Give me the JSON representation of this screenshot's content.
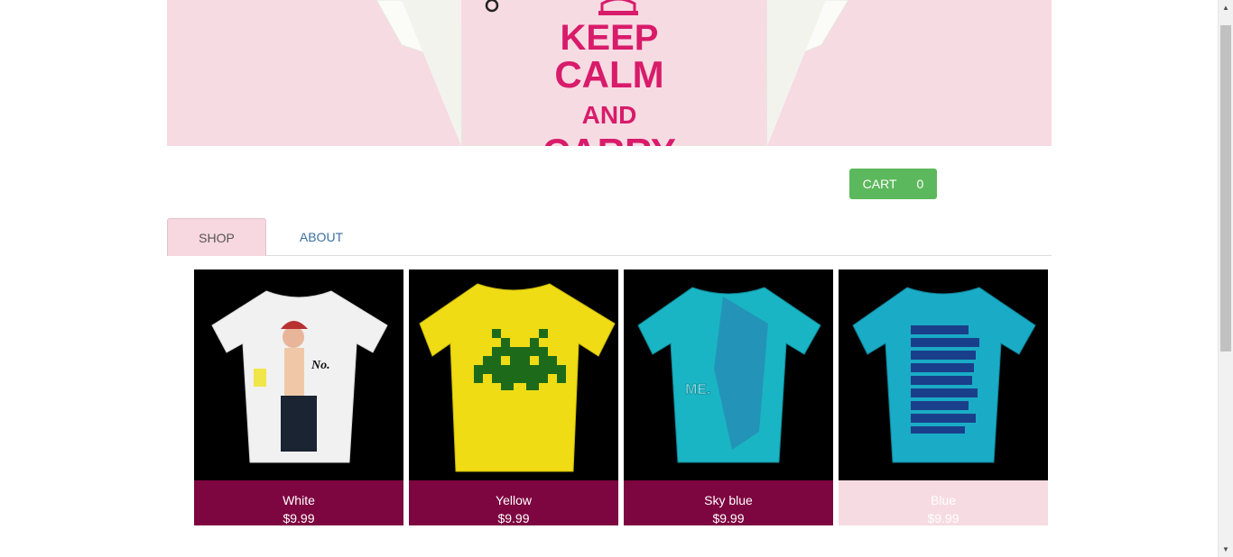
{
  "banner": {
    "line1": "KEEP",
    "line2": "CALM",
    "line3": "AND",
    "line4": "CARRY"
  },
  "cart": {
    "label": "CART",
    "count": "0"
  },
  "tabs": [
    {
      "label": "SHOP"
    },
    {
      "label": "ABOUT"
    }
  ],
  "products": [
    {
      "name": "White",
      "price": "$9.99",
      "shirt_color": "#f1f1f1"
    },
    {
      "name": "Yellow",
      "price": "$9.99",
      "shirt_color": "#f0dc14"
    },
    {
      "name": "Sky blue",
      "price": "$9.99",
      "shirt_color": "#1ab5c4"
    },
    {
      "name": "Blue",
      "price": "$9.99",
      "shirt_color": "#1aacc6"
    }
  ],
  "colors": {
    "banner_bg": "#f7dbe2",
    "banner_text": "#d81b6a",
    "cart_button": "#5cb85c",
    "caption_bg": "#7d0540"
  }
}
